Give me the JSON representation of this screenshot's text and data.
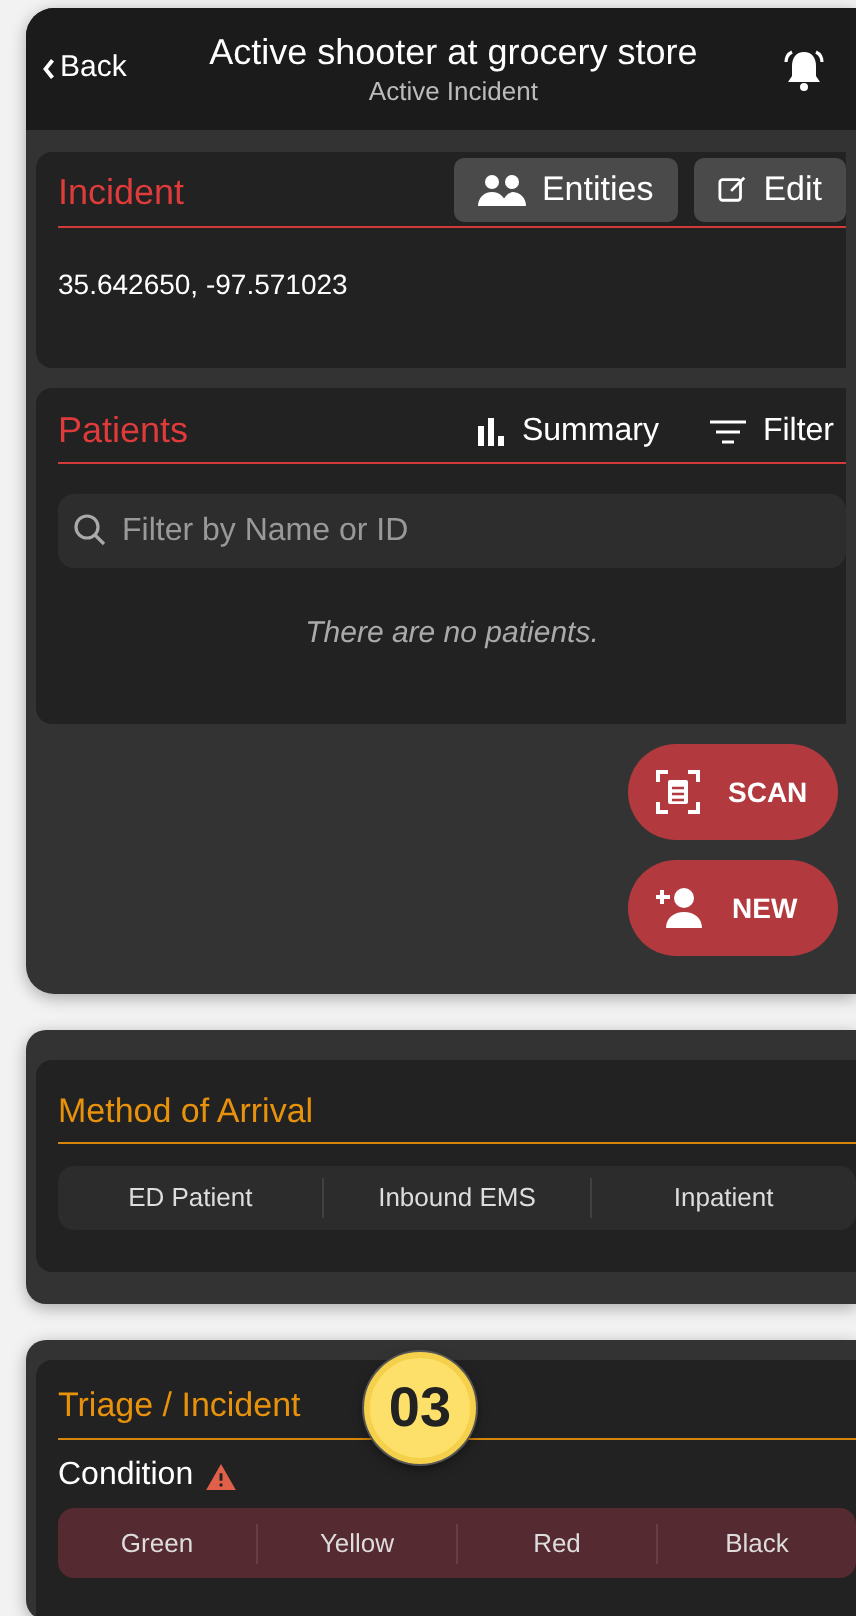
{
  "header": {
    "back": "Back",
    "title": "Active shooter at grocery store",
    "subtitle": "Active Incident"
  },
  "incident": {
    "title": "Incident",
    "buttons": [
      {
        "kind": "entities",
        "label": "Entities"
      },
      {
        "kind": "edit",
        "label": "Edit"
      }
    ],
    "coordinates": "35.642650, -97.571023"
  },
  "patients": {
    "title": "Patients",
    "actions": [
      {
        "kind": "summary",
        "label": "Summary"
      },
      {
        "kind": "filter",
        "label": "Filter"
      }
    ],
    "search": {
      "placeholder": "Filter by Name or ID"
    },
    "empty": "There are no patients."
  },
  "fabs": [
    {
      "kind": "scan",
      "label": "SCAN"
    },
    {
      "kind": "new",
      "label": "NEW"
    }
  ],
  "arrival": {
    "title": "Method of Arrival",
    "options": [
      "ED Patient",
      "Inbound EMS",
      "Inpatient"
    ]
  },
  "triage": {
    "title": "Triage / Incident",
    "badge": "03",
    "condition_label": "Condition",
    "options": [
      "Green",
      "Yellow",
      "Red",
      "Black"
    ]
  }
}
